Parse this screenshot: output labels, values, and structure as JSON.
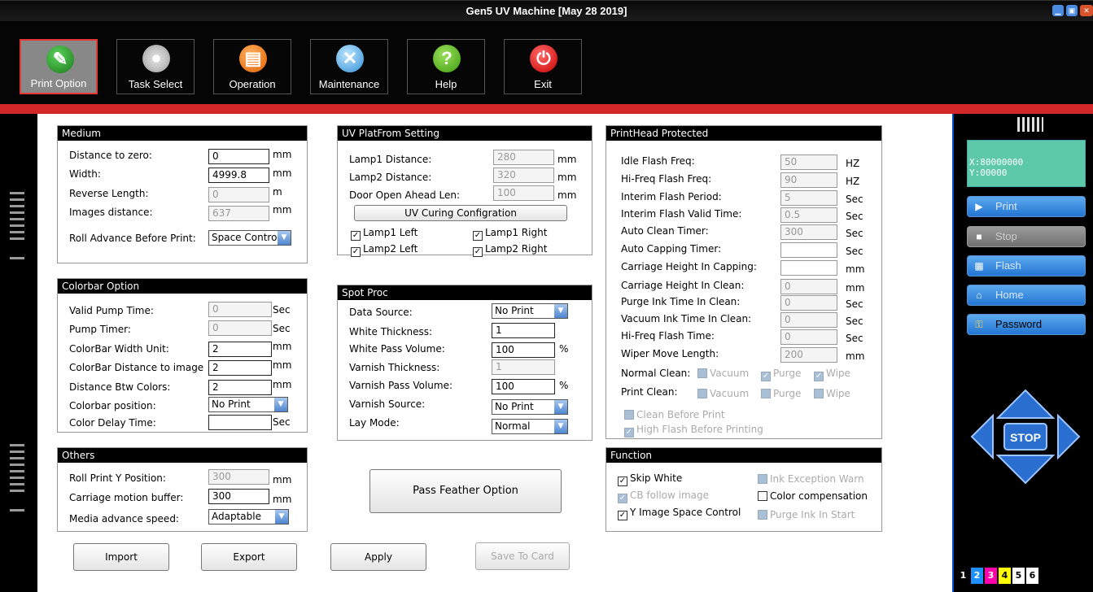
{
  "window": {
    "title": "Gen5 UV Machine [May 28 2019]"
  },
  "toolbar": [
    {
      "label": "Print Option",
      "icon": "print-option-icon"
    },
    {
      "label": "Task Select",
      "icon": "disc-icon"
    },
    {
      "label": "Operation",
      "icon": "printer-icon"
    },
    {
      "label": "Maintenance",
      "icon": "tools-icon"
    },
    {
      "label": "Help",
      "icon": "help-icon"
    },
    {
      "label": "Exit",
      "icon": "power-icon"
    }
  ],
  "medium": {
    "title": "Medium",
    "distance_to_zero": {
      "label": "Distance to zero:",
      "value": "0",
      "unit": "mm"
    },
    "width": {
      "label": "Width:",
      "value": "4999.8",
      "unit": "mm"
    },
    "reverse_length": {
      "label": "Reverse Length:",
      "value": "0",
      "unit": "m"
    },
    "images_distance": {
      "label": "Images distance:",
      "value": "637",
      "unit": "mm"
    },
    "roll_advance": {
      "label": "Roll Advance Before Print:",
      "value": "Space Contro"
    }
  },
  "uv": {
    "title": "UV PlatFrom Setting",
    "lamp1_distance": {
      "label": "Lamp1 Distance:",
      "value": "280",
      "unit": "mm"
    },
    "lamp2_distance": {
      "label": "Lamp2 Distance:",
      "value": "320",
      "unit": "mm"
    },
    "door_open": {
      "label": "Door Open Ahead Len:",
      "value": "100",
      "unit": "mm"
    },
    "curing_button": "UV Curing Configration",
    "lamp1_left": "Lamp1 Left",
    "lamp1_right": "Lamp1 Right",
    "lamp2_left": "Lamp2 Left",
    "lamp2_right": "Lamp2 Right"
  },
  "printhead": {
    "title": "PrintHead Protected",
    "rows": [
      {
        "label": "Idle Flash Freq:",
        "value": "50",
        "unit": "HZ"
      },
      {
        "label": "Hi-Freq Flash Freq:",
        "value": "90",
        "unit": "HZ"
      },
      {
        "label": "Interim Flash Period:",
        "value": "5",
        "unit": "Sec"
      },
      {
        "label": "Interim Flash Valid Time:",
        "value": "0.5",
        "unit": "Sec"
      },
      {
        "label": "Auto Clean  Timer:",
        "value": "300",
        "unit": "Sec"
      },
      {
        "label": "Auto Capping Timer:",
        "value": "",
        "unit": "Sec"
      },
      {
        "label": "Carriage  Height In Capping:",
        "value": "",
        "unit": "mm"
      },
      {
        "label": "Carriage Height  In Clean:",
        "value": "0",
        "unit": "mm"
      },
      {
        "label": "Purge Ink Time In Clean:",
        "value": "0",
        "unit": "Sec"
      },
      {
        "label": "Vacuum Ink Time In Clean:",
        "value": "0",
        "unit": "Sec"
      },
      {
        "label": "Hi-Freq Flash Time:",
        "value": "0",
        "unit": "Sec"
      },
      {
        "label": "Wiper Move Length:",
        "value": "200",
        "unit": "mm"
      }
    ],
    "normal_clean": "Normal Clean:",
    "print_clean": "Print Clean:",
    "vacuum": "Vacuum",
    "purge": "Purge",
    "wipe": "Wipe",
    "clean_before_print": "Clean Before Print",
    "high_flash": "High Flash Before Printing"
  },
  "colorbar": {
    "title": "Colorbar Option",
    "valid_pump": {
      "label": "Valid Pump Time:",
      "value": "0",
      "unit": "Sec"
    },
    "pump_timer": {
      "label": "Pump Timer:",
      "value": "0",
      "unit": "Sec"
    },
    "width_unit": {
      "label": "ColorBar Width Unit:",
      "value": "2",
      "unit": "mm"
    },
    "distance_image": {
      "label": "ColorBar Distance to image",
      "value": "2",
      "unit": "mm"
    },
    "distance_colors": {
      "label": "Distance Btw Colors:",
      "value": "2",
      "unit": "mm"
    },
    "position": {
      "label": "Colorbar position:",
      "value": "No Print"
    },
    "delay": {
      "label": "Color Delay Time:",
      "value": "",
      "unit": "Sec"
    }
  },
  "spot": {
    "title": "Spot Proc",
    "data_source": {
      "label": "Data Source:",
      "value": "No Print"
    },
    "white_thickness": {
      "label": "White Thickness:",
      "value": "1"
    },
    "white_pass": {
      "label": "White Pass Volume:",
      "value": "100",
      "unit": "%"
    },
    "varnish_thickness": {
      "label": "Varnish Thickness:",
      "value": "1"
    },
    "varnish_pass": {
      "label": "Varnish Pass Volume:",
      "value": "100",
      "unit": "%"
    },
    "varnish_source": {
      "label": "Varnish Source:",
      "value": "No Print"
    },
    "lay_mode": {
      "label": "Lay Mode:",
      "value": "Normal"
    }
  },
  "others": {
    "title": "Others",
    "roll_y": {
      "label": "Roll Print Y Position:",
      "value": "300",
      "unit": "mm"
    },
    "carriage_buffer": {
      "label": "Carriage motion buffer:",
      "value": "300",
      "unit": "mm"
    },
    "media_speed": {
      "label": "Media advance speed:",
      "value": "Adaptable"
    }
  },
  "pass_feather": "Pass Feather Option",
  "function": {
    "title": "Function",
    "skip_white": "Skip White",
    "cb_follow": "CB follow image",
    "y_image": "Y Image Space Control",
    "ink_exception": "Ink Exception Warn",
    "color_comp": "Color compensation",
    "purge_start": "Purge Ink  In Start"
  },
  "buttons": {
    "import": "Import",
    "export": "Export",
    "apply": "Apply",
    "save_card": "Save To Card"
  },
  "side": {
    "x": "X:80000000",
    "y": "Y:00000",
    "print": "Print",
    "stop": "Stop",
    "flash": "Flash",
    "home": "Home",
    "password": "Password",
    "stop_pad": "STOP"
  },
  "inks": [
    {
      "n": "1",
      "bg": "#000000",
      "fg": "#ffffff"
    },
    {
      "n": "2",
      "bg": "#1e90ff",
      "fg": "#ffffff"
    },
    {
      "n": "3",
      "bg": "#ff00aa",
      "fg": "#ffffff"
    },
    {
      "n": "4",
      "bg": "#ffff00",
      "fg": "#000000"
    },
    {
      "n": "5",
      "bg": "#ffffff",
      "fg": "#000000"
    },
    {
      "n": "6",
      "bg": "#ffffff",
      "fg": "#000000"
    }
  ],
  "colors": {
    "accent_red": "#d3282a",
    "side_blue": "#2275d2",
    "coord_green": "#5dc9a8"
  }
}
